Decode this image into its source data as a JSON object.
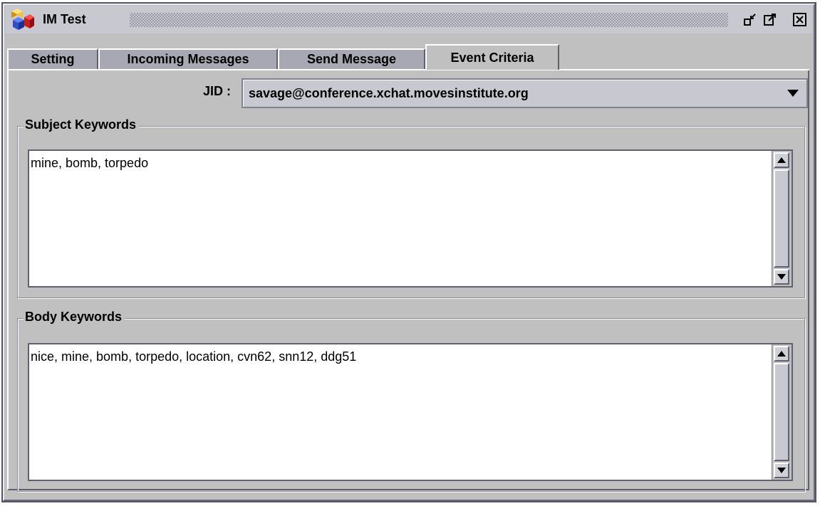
{
  "window": {
    "title": "IM Test",
    "controls": [
      "minimize-icon",
      "maximize-icon",
      "close-icon"
    ]
  },
  "tabs": [
    {
      "label": "Setting",
      "active": false
    },
    {
      "label": "Incoming Messages",
      "active": false
    },
    {
      "label": "Send Message",
      "active": false
    },
    {
      "label": "Event Criteria",
      "active": true
    }
  ],
  "jid": {
    "label": "JID :",
    "selected": "savage@conference.xchat.movesinstitute.org"
  },
  "subject_keywords": {
    "title": "Subject Keywords",
    "value": "mine, bomb, torpedo"
  },
  "body_keywords": {
    "title": "Body Keywords",
    "value": "nice, mine, bomb, torpedo, location, cvn62, snn12, ddg51"
  },
  "colors": {
    "panel": "#c0c0c0",
    "inactive_tab": "#a8a8b4",
    "frame": "#555566"
  }
}
